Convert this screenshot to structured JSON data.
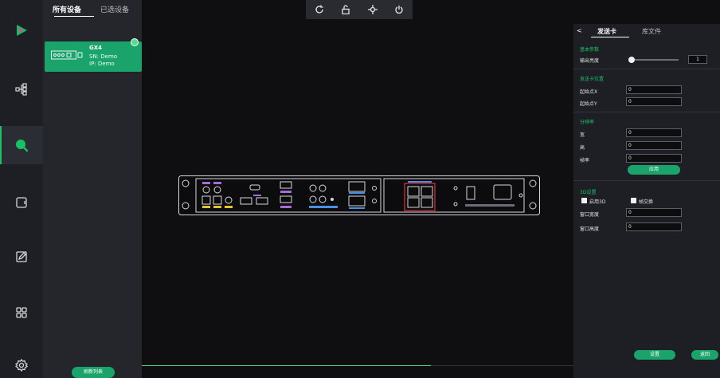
{
  "left_tabs": {
    "all_devices": "所有设备",
    "selected_devices": "已选设备"
  },
  "device": {
    "name": "GX4",
    "sn": "SN: Demo",
    "ip": "IP: Demo"
  },
  "refresh_label": "刷新列表",
  "nav_items": [
    "play-logo-icon",
    "topology-icon",
    "search-icon",
    "screen-icon",
    "edit-icon",
    "grid-icon",
    "settings-icon"
  ],
  "toolbar_icons": [
    "refresh-icon",
    "lock-icon",
    "locate-icon",
    "power-icon"
  ],
  "right_panel": {
    "back": "<",
    "tab_send_card": "发送卡",
    "tab_library": "库文件",
    "basic_params": "基本参数",
    "output_brightness": "输出亮度",
    "brightness_value": "1",
    "brightness_fraction": 0.05,
    "send_card_position": "发送卡位置",
    "start_x_label": "起始点X",
    "start_x": "0",
    "start_y_label": "起始点Y",
    "start_y": "0",
    "resolution": "分辨率",
    "width_label": "宽",
    "width": "0",
    "height_label": "高",
    "height": "0",
    "frame_rate_label": "帧率",
    "frame_rate": "0",
    "apply": "应用",
    "section_3d": "3D设置",
    "enable_3d": "启用3D",
    "frame_swap": "帧交换",
    "window_width_label": "窗口宽度",
    "window_width": "0",
    "window_height_label": "窗口高度",
    "window_height": "0",
    "settings_button": "设置",
    "return_button": "返回"
  },
  "colors": {
    "accent": "#18c264",
    "card": "#1aa36b",
    "highlight_red": "#e0303a"
  },
  "progress_fraction": 0.5
}
